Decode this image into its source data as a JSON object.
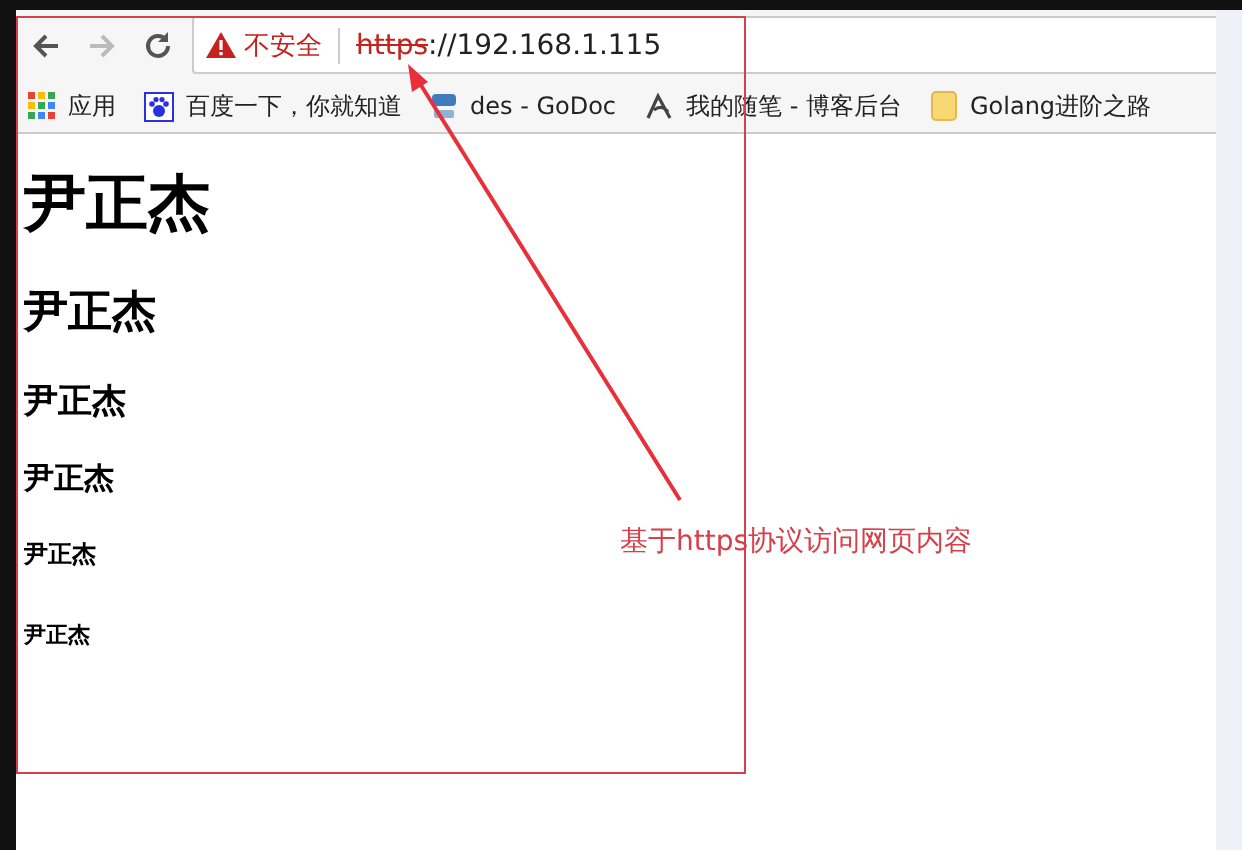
{
  "toolbar": {
    "security_label": "不安全",
    "url_scheme": "https",
    "url_rest": "://192.168.1.115",
    "forward_disabled": true
  },
  "bookmarks": [
    {
      "kind": "apps",
      "label": "应用"
    },
    {
      "kind": "paw",
      "label": "百度一下，你就知道"
    },
    {
      "kind": "go",
      "label": "des - GoDoc"
    },
    {
      "kind": "blog",
      "label": "我的随笔 - 博客后台"
    },
    {
      "kind": "folder",
      "label": "Golang进阶之路"
    }
  ],
  "headings": [
    "尹正杰",
    "尹正杰",
    "尹正杰",
    "尹正杰",
    "尹正杰",
    "尹正杰"
  ],
  "annotation": {
    "text": "基于https协议访问网页内容"
  }
}
